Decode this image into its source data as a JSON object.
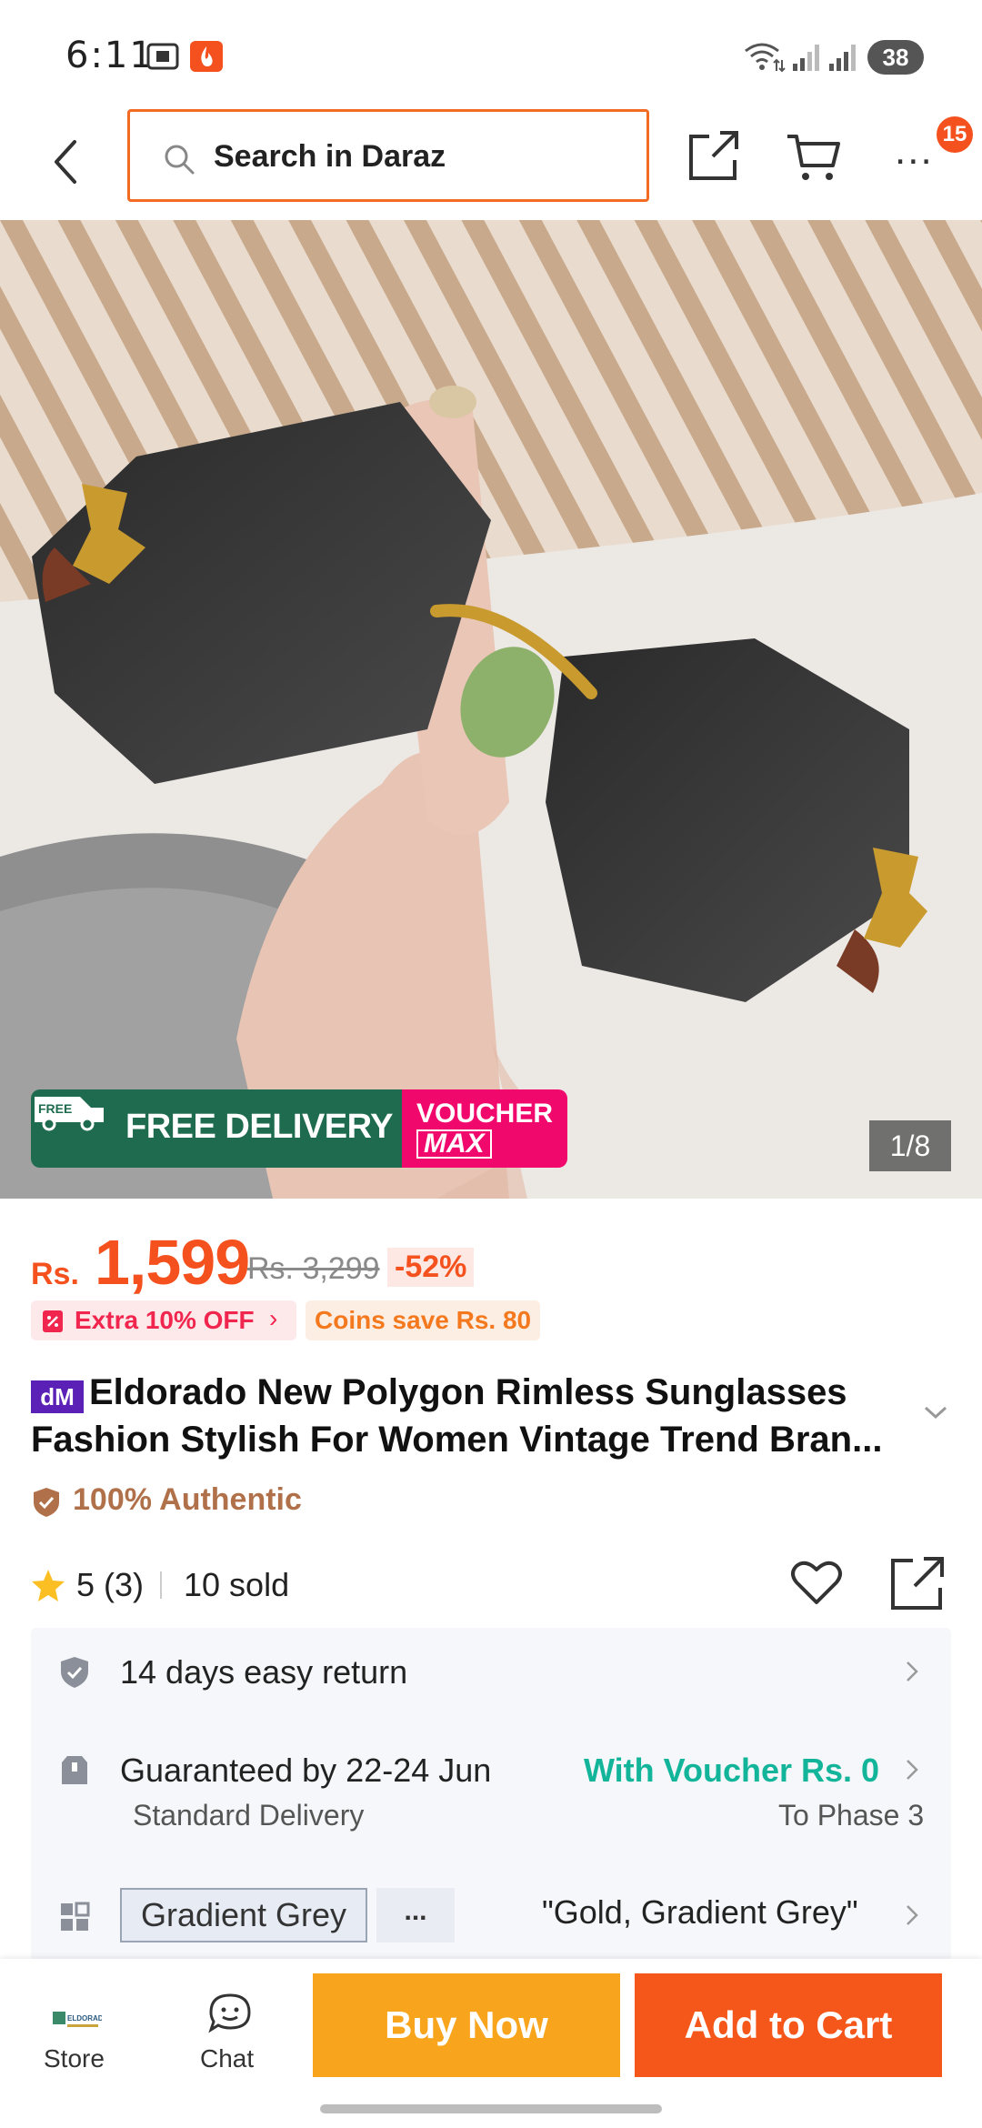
{
  "status_bar": {
    "time": "6:11",
    "battery": "38"
  },
  "nav": {
    "search_placeholder": "Search in Daraz",
    "cart_badge": "15"
  },
  "hero": {
    "free_tag": "FREE",
    "free_delivery": "FREE DELIVERY",
    "voucher_line1": "VOUCHER",
    "voucher_line2": "MAX",
    "image_counter": "1/8"
  },
  "price": {
    "currency": "Rs.",
    "current": "1,599",
    "original": "Rs. 3,299",
    "discount": "-52%"
  },
  "promos": {
    "extra_off": "Extra 10% OFF",
    "coins": "Coins save Rs. 80"
  },
  "product": {
    "brand_badge": "dM",
    "title": "Eldorado New Polygon Rimless Sunglasses Fashion Stylish For Women Vintage Trend Bran...",
    "authentic": "100% Authentic",
    "rating": "5",
    "rating_count": "(3)",
    "sold": "10 sold"
  },
  "info": {
    "returns": "14 days easy return",
    "delivery_title": "Guaranteed by 22-24 Jun",
    "delivery_sub": "Standard Delivery",
    "voucher_offer": "With Voucher Rs. 0",
    "phase": "To Phase 3",
    "variant_chip": "Gradient Grey",
    "variant_more": "...",
    "variant_selected": "\"Gold, Gradient Grey\""
  },
  "bottom": {
    "store_logo_text": "ELDORADO",
    "store": "Store",
    "chat": "Chat",
    "buy_now": "Buy Now",
    "add_to_cart": "Add to Cart"
  },
  "colors": {
    "brand_orange": "#f4511e",
    "buy_now": "#f8a51d",
    "add_to_cart": "#f5571a",
    "voucher_green": "#12b59a",
    "authentic_brown": "#b0714a"
  }
}
